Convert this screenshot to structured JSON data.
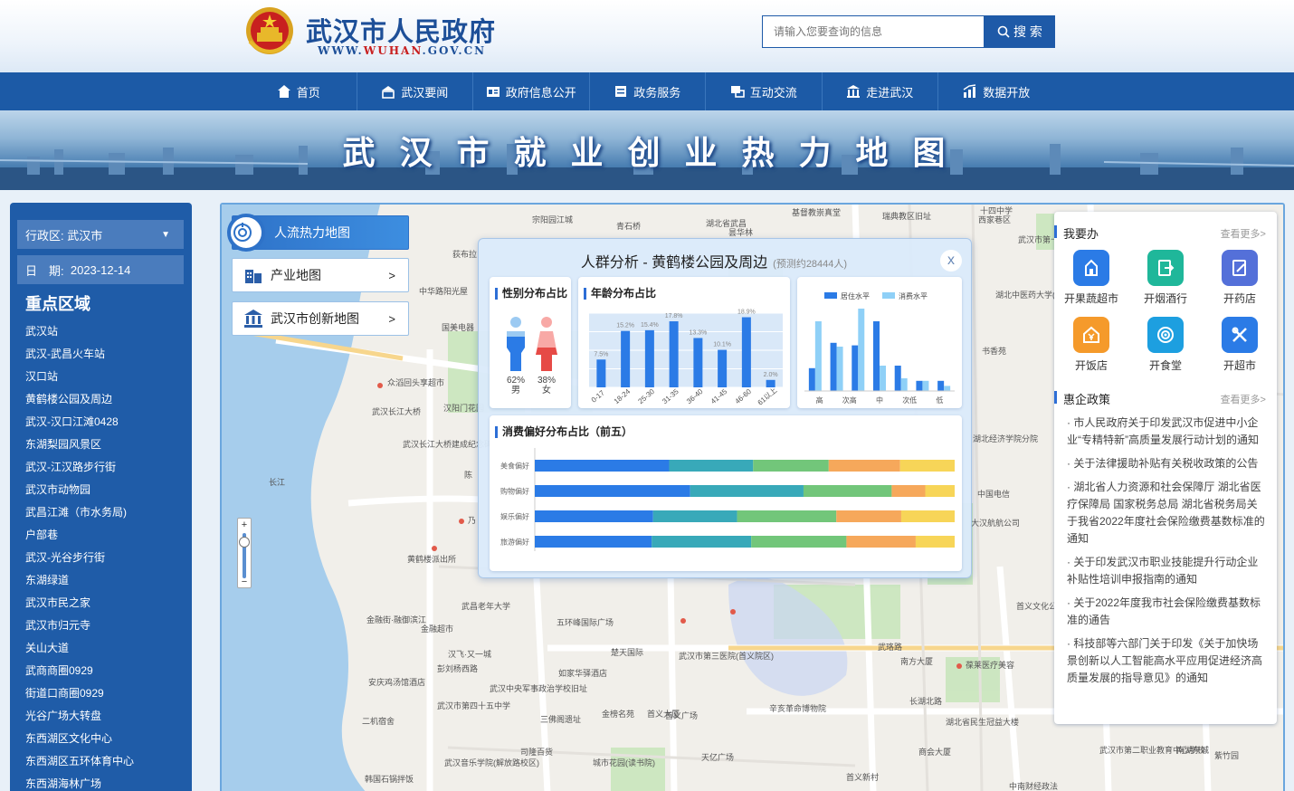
{
  "header": {
    "site_name_cn": "武汉市人民政府",
    "site_url_prefix": "WWW.",
    "site_url_mid": "WUHAN",
    "site_url_suffix": ".GOV.CN",
    "search_placeholder": "请输入您要查询的信息",
    "search_button": "搜 索"
  },
  "nav": {
    "items": [
      {
        "label": "首页",
        "icon": "home-icon"
      },
      {
        "label": "武汉要闻",
        "icon": "news-icon"
      },
      {
        "label": "政府信息公开",
        "icon": "info-icon"
      },
      {
        "label": "政务服务",
        "icon": "service-icon"
      },
      {
        "label": "互动交流",
        "icon": "interact-icon"
      },
      {
        "label": "走进武汉",
        "icon": "landmark-icon"
      },
      {
        "label": "数据开放",
        "icon": "data-icon"
      }
    ]
  },
  "banner": {
    "title": "武汉市就业创业热力地图"
  },
  "left_panel": {
    "district_label": "行政区:",
    "district_value": "武汉市",
    "date_label": "日　期:",
    "date_value": "2023-12-14",
    "heading": "重点区域",
    "areas": [
      "武汉站",
      "武汉-武昌火车站",
      "汉口站",
      "黄鹤楼公园及周边",
      "武汉-汉口江滩0428",
      "东湖梨园风景区",
      "武汉-江汉路步行街",
      "武汉市动物园",
      "武昌江滩（市水务局)",
      "户部巷",
      "武汉-光谷步行街",
      "东湖绿道",
      "武汉市民之家",
      "武汉市归元寺",
      "关山大道",
      "武商商圈0929",
      "街道口商圈0929",
      "光谷广场大转盘",
      "东西湖区文化中心",
      "东西湖区五环体育中心",
      "东西湖海林广场"
    ]
  },
  "map_tabs": {
    "heat": "人流热力地图",
    "industry": "产业地图",
    "innovation": "武汉市创新地图"
  },
  "map_labels": [
    "宗阳园江城",
    "青石桥",
    "湖北省武昌",
    "昙华林",
    "基督教崇真堂",
    "瑞典教区旧址",
    "十四中学",
    "西家巷区",
    "武汉市第十四中学",
    "荻布拉",
    "中华路阳光屋",
    "国美电器",
    "书香苑",
    "湖北中医药大学(昙华林校区)",
    "众滔回头享超市",
    "汉阳门花园",
    "武汉长江大桥",
    "武汉长江大桥建成纪念碑",
    "湖北经济学院分院",
    "中国电信",
    "大汉航航公司",
    "黄鹤楼派出所",
    "武昌老年大学",
    "金融街·融御滨江",
    "金融超市",
    "五环峰国际广场",
    "楚天国际",
    "汉飞·又一城",
    "彭刘杨西路",
    "如家华驿酒店",
    "安庆鸡汤馆酒店",
    "武汉中央军事政治学校旧址",
    "武汉市第四十五中学",
    "二机宿舍",
    "三佛阁遗址",
    "金榜名苑",
    "首义大厦",
    "首义广场",
    "辛亥革命博物院",
    "武珞路",
    "南方大厦",
    "葆莱医疗美容",
    "首义文化公园",
    "湖北省民生冠益大楼",
    "长湖北路",
    "司隆百货",
    "武汉音乐学院(解放路校区)",
    "城市花园(读书院)",
    "天亿广场",
    "韩国石锅拌饭",
    "首义新村",
    "中南财经政法",
    "南湖东城",
    "紫竹园",
    "武汉市第二职业教育中心学校",
    "商会大厦",
    "武汉市第三医院(首义院区)",
    "乃",
    "陈",
    "汇",
    "长江"
  ],
  "popup": {
    "title": "人群分析 - 黄鹤楼公园及周边",
    "estimate": "(预测约28444人)",
    "close": "x",
    "gender": {
      "title": "性别分布占比",
      "male_pct": "62%",
      "male": "男",
      "female_pct": "38%",
      "female": "女"
    },
    "age_title": "年龄分布占比",
    "level_title": "",
    "consume_title": "消费偏好分布占比（前五）"
  },
  "chart_data": [
    {
      "type": "bar",
      "title": "年龄分布占比",
      "categories": [
        "0-17",
        "18-24",
        "25-30",
        "31-35",
        "36-40",
        "41-45",
        "46-60",
        "61以上"
      ],
      "values": [
        7.5,
        15.2,
        15.4,
        17.8,
        13.3,
        10.1,
        18.9,
        2.0
      ],
      "ylim": [
        0,
        20
      ],
      "grid": true,
      "colors": {
        "bar": "#2b7be6",
        "bg": "#d9e8f8"
      }
    },
    {
      "type": "bar",
      "categories": [
        "高",
        "次高",
        "中",
        "次低",
        "低"
      ],
      "series": [
        {
          "name": "居住水平",
          "values": [
            18,
            38,
            36,
            55,
            20,
            8,
            8
          ]
        },
        {
          "name": "消费水平",
          "values": [
            55,
            35,
            65,
            20,
            10,
            8,
            4
          ]
        }
      ],
      "ylim": [
        0,
        70
      ],
      "legend": "top-center",
      "colors": {
        "居住水平": "#2b7be6",
        "消费水平": "#8fd0f7"
      }
    },
    {
      "type": "bar",
      "title": "消费偏好分布占比（前五）",
      "orientation": "horizontal-stacked",
      "categories": [
        "美食偏好",
        "购物偏好",
        "娱乐偏好",
        "旅游偏好"
      ],
      "series": [
        {
          "values": [
            32,
            37,
            31,
            27
          ]
        },
        {
          "values": [
            20,
            27,
            22,
            23
          ]
        },
        {
          "values": [
            18,
            21,
            26,
            22
          ]
        },
        {
          "values": [
            17,
            8,
            17,
            16
          ]
        },
        {
          "values": [
            13,
            7,
            14,
            9
          ]
        }
      ],
      "xlim": [
        0,
        100
      ],
      "colors": [
        "#2b7be6",
        "#38a9b9",
        "#72c67a",
        "#f6a85b",
        "#f7d558"
      ]
    }
  ],
  "right_panel": {
    "todo_title": "我要办",
    "todo_more": "查看更多>",
    "services": [
      {
        "label": "开果蔬超市",
        "icon": "store-icon",
        "color": "#2b7be6"
      },
      {
        "label": "开烟酒行",
        "icon": "export-icon",
        "color": "#1fb79a"
      },
      {
        "label": "开药店",
        "icon": "edit-icon",
        "color": "#5470d9"
      },
      {
        "label": "开饭店",
        "icon": "yen-house-icon",
        "color": "#f59a2b"
      },
      {
        "label": "开食堂",
        "icon": "target-icon",
        "color": "#1d9fe0"
      },
      {
        "label": "开超市",
        "icon": "tools-icon",
        "color": "#2b7be6"
      }
    ],
    "policy_title": "惠企政策",
    "policy_more": "查看更多>",
    "policies": [
      "· 市人民政府关于印发武汉市促进中小企业“专精特新”高质量发展行动计划的通知",
      "· 关于法律援助补贴有关税收政策的公告",
      "· 湖北省人力资源和社会保障厅 湖北省医疗保障局 国家税务总局 湖北省税务局关于我省2022年度社会保险缴费基数标准的通知",
      "· 关于印发武汉市职业技能提升行动企业补贴性培训申报指南的通知",
      "· 关于2022年度我市社会保险缴费基数标准的通告",
      "· 科技部等六部门关于印发《关于加快场景创新以人工智能高水平应用促进经济高质量发展的指导意见》的通知"
    ]
  },
  "colors": {
    "brand": "#1c5aa6",
    "accent": "#2b7be6",
    "nav": "#1c5aa6"
  }
}
